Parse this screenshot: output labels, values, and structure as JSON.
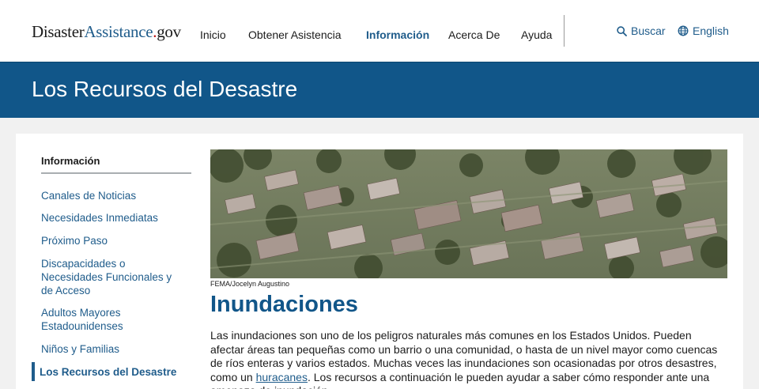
{
  "header": {
    "logo": {
      "part1": "Disaster",
      "part2": "Assistance",
      "dot": ".",
      "part3": "gov"
    },
    "nav": [
      {
        "label": "Inicio"
      },
      {
        "label": "Obtener Asistencia"
      },
      {
        "label": "Información"
      },
      {
        "label": "Acerca De"
      },
      {
        "label": "Ayuda"
      }
    ],
    "search_label": "Buscar",
    "language_label": "English"
  },
  "banner": {
    "title": "Los Recursos del Desastre"
  },
  "sidebar": {
    "heading": "Información",
    "items": [
      {
        "label": "Canales de Noticias"
      },
      {
        "label": "Necesidades Inmediatas"
      },
      {
        "label": "Próximo Paso"
      },
      {
        "label": "Discapacidades o Necesidades Funcionales y de Acceso"
      },
      {
        "label": "Adultos Mayores Estadounidenses"
      },
      {
        "label": "Niños y Familias"
      },
      {
        "label": "Los Recursos del Desastre"
      }
    ]
  },
  "main": {
    "photo_caption": "FEMA/Jocelyn Augustino",
    "title": "Inundaciones",
    "body_before": "Las inundaciones son uno de los peligros naturales más comunes en los Estados Unidos. Pueden afectar áreas tan pequeñas como un barrio o una comunidad, o hasta de un nivel mayor como cuencas de ríos enteras y varios estados. Muchas veces las inundaciones son ocasionadas por otros desastres, como un ",
    "body_link": "huracanes",
    "body_after": ". Los recursos a continuación le pueden ayudar a saber cómo responder ante una amenaza de inundación."
  },
  "colors": {
    "brand_blue": "#115689",
    "link_blue": "#1f5c8b",
    "logo_dot_red": "#b50909"
  }
}
